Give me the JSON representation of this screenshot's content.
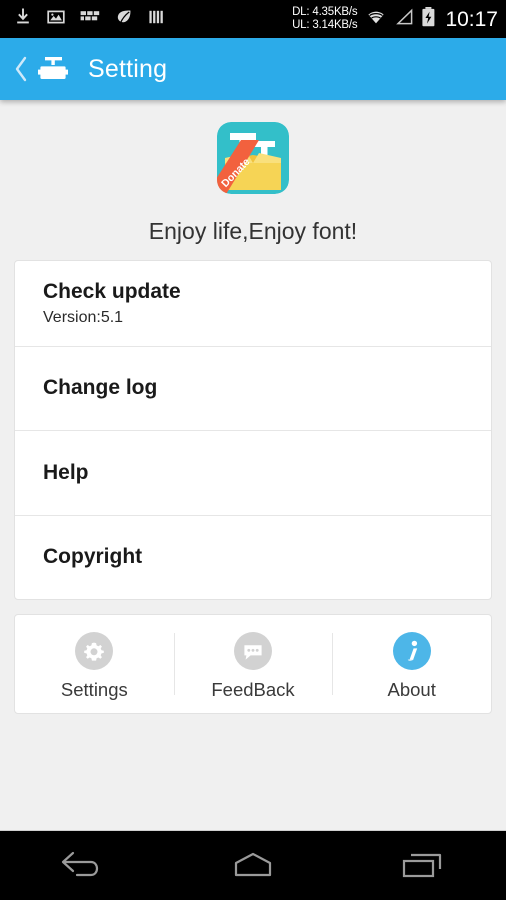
{
  "status_bar": {
    "icons": [
      {
        "name": "download-icon"
      },
      {
        "name": "image-icon"
      },
      {
        "name": "app-grid-icon"
      },
      {
        "name": "leaf-icon"
      },
      {
        "name": "bars-icon"
      }
    ],
    "download_speed": "DL: 4.35KB/s",
    "upload_speed": "UL: 3.14KB/s",
    "wifi_icon": "wifi-icon",
    "signal_icon": "signal-triangle-icon",
    "battery_icon": "battery-charging-icon",
    "time": "10:17"
  },
  "action_bar": {
    "back_icon": "back-chevron-icon",
    "app_icon": "app-logo-icon",
    "title": "Setting",
    "background_color": "#2cabe9"
  },
  "hero": {
    "logo": {
      "name": "app-logo",
      "letters": "TT",
      "ribbon_text": "Donate",
      "teal_color": "#33bfc9",
      "box_color": "#f6d455",
      "ribbon_color": "#f2613e"
    },
    "tagline": "Enjoy life,Enjoy font!"
  },
  "list": {
    "items": [
      {
        "title": "Check update",
        "subtitle": "Version:5.1"
      },
      {
        "title": "Change log",
        "subtitle": ""
      },
      {
        "title": "Help",
        "subtitle": ""
      },
      {
        "title": "Copyright",
        "subtitle": ""
      }
    ]
  },
  "tab_bar": {
    "tabs": [
      {
        "label": "Settings",
        "icon": "gear-icon",
        "active": false,
        "color": "#d2d2d2"
      },
      {
        "label": "FeedBack",
        "icon": "chat-bubble-icon",
        "active": false,
        "color": "#d2d2d2"
      },
      {
        "label": "About",
        "icon": "info-icon",
        "active": true,
        "color": "#4db6e8"
      }
    ]
  },
  "nav_bar": {
    "buttons": [
      {
        "name": "back-button",
        "icon": "nav-back-icon"
      },
      {
        "name": "home-button",
        "icon": "nav-home-icon"
      },
      {
        "name": "recents-button",
        "icon": "nav-recents-icon"
      }
    ]
  }
}
